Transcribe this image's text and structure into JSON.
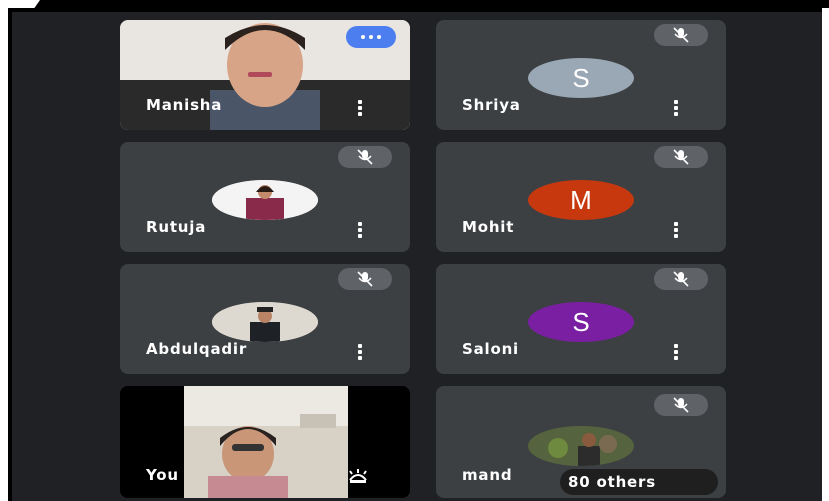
{
  "participants": [
    {
      "name": "Manisha",
      "type": "video",
      "speaking": true
    },
    {
      "name": "Shriya",
      "type": "initial",
      "initial": "S",
      "avatar_color": "#9aa7b4",
      "muted": true
    },
    {
      "name": "Rutuja",
      "type": "photo",
      "muted": true
    },
    {
      "name": "Mohit",
      "type": "initial",
      "initial": "M",
      "avatar_color": "#c8380e",
      "muted": true
    },
    {
      "name": "Abdulqadir",
      "type": "photo",
      "muted": true
    },
    {
      "name": "Saloni",
      "type": "initial",
      "initial": "S",
      "avatar_color": "#7b1fa2",
      "muted": true
    },
    {
      "name": "You",
      "type": "self-video"
    },
    {
      "name": "mand",
      "type": "photo",
      "muted": true
    }
  ],
  "others_label": "80 others",
  "icons": {
    "mute": "mic-off-icon",
    "more": "more-vert-icon",
    "speaking": "speaking-dots-icon",
    "self_view": "self-view-icon"
  },
  "colors": {
    "background": "#202124",
    "tile": "#3c4043",
    "speaking_badge": "#4d7ef0",
    "mute_badge": "#5f6368"
  }
}
